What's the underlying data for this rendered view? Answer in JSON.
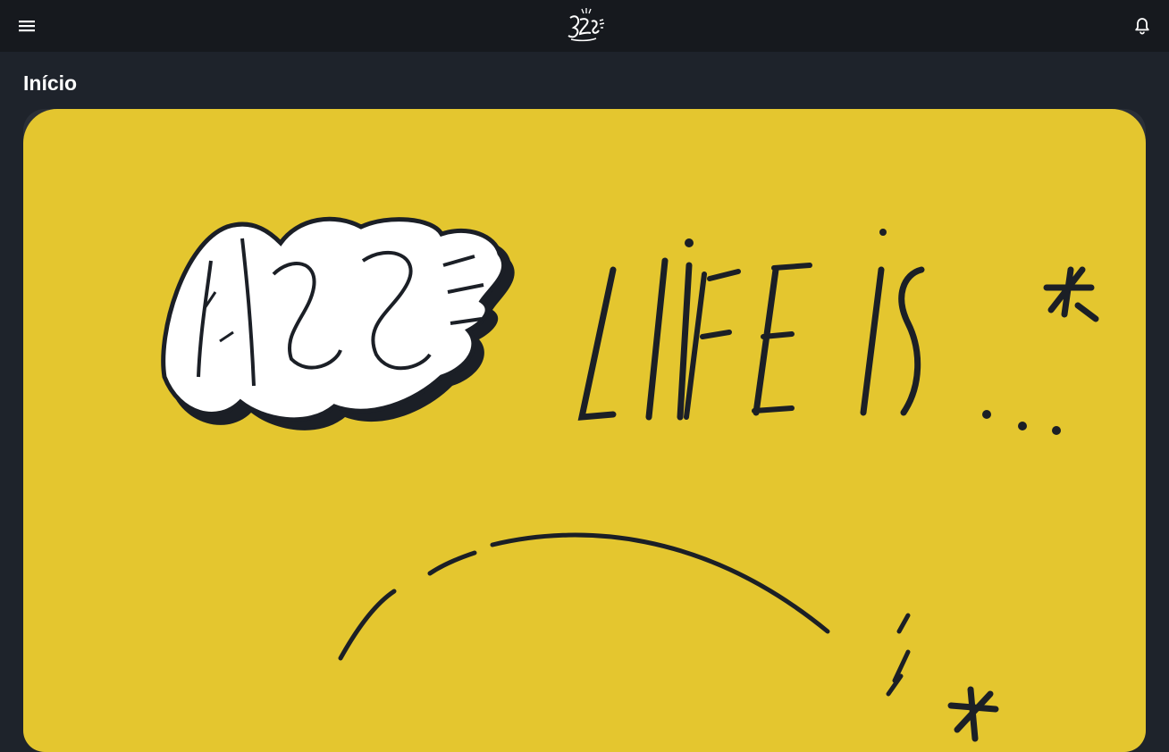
{
  "header": {
    "menu_icon": "hamburger-menu-icon",
    "logo_icon": "graffiti-logo-icon",
    "notification_icon": "bell-icon"
  },
  "page": {
    "title": "Início"
  },
  "feed": {
    "card_image": "yellow-illustration-life-is",
    "colors": {
      "card_background": "#e4c62f",
      "ink": "#1b1f26",
      "header_background": "#16191e",
      "page_background": "#1e232b"
    }
  }
}
